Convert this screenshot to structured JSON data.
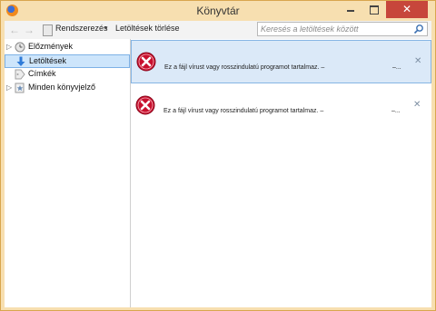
{
  "window": {
    "title": "Könyvtár",
    "close_glyph": "✕"
  },
  "toolbar": {
    "back_glyph": "←",
    "forward_glyph": "→",
    "organize_label": "Rendszerezés",
    "organize_chevron": "▾",
    "clear_label": "Letöltések törlése",
    "search_placeholder": "Keresés a letöltések között"
  },
  "sidebar": {
    "items": [
      {
        "label": "Előzmények",
        "icon": "history-clock-icon",
        "expandable": true,
        "selected": false
      },
      {
        "label": "Letöltések",
        "icon": "download-arrow-icon",
        "expandable": false,
        "selected": true
      },
      {
        "label": "Címkék",
        "icon": "tag-icon",
        "expandable": false,
        "selected": false
      },
      {
        "label": "Minden könyvjelző",
        "icon": "bookmarks-star-icon",
        "expandable": true,
        "selected": false
      }
    ],
    "twisty_glyph": "▷"
  },
  "downloads": [
    {
      "message": "Ez a fájl vírust vagy rosszindulatú programot tartalmaz. –",
      "size": "–...",
      "cancel_glyph": "✕",
      "selected": true,
      "icon": "error-icon"
    },
    {
      "message": "Ez a fájl vírust vagy rosszindulatú programot tartalmaz. –",
      "size": "–...",
      "cancel_glyph": "✕",
      "selected": false,
      "icon": "error-icon"
    }
  ],
  "colors": {
    "selection": "#cde5fb",
    "error_red": "#c8102e",
    "frame": "#f7dfb0"
  }
}
